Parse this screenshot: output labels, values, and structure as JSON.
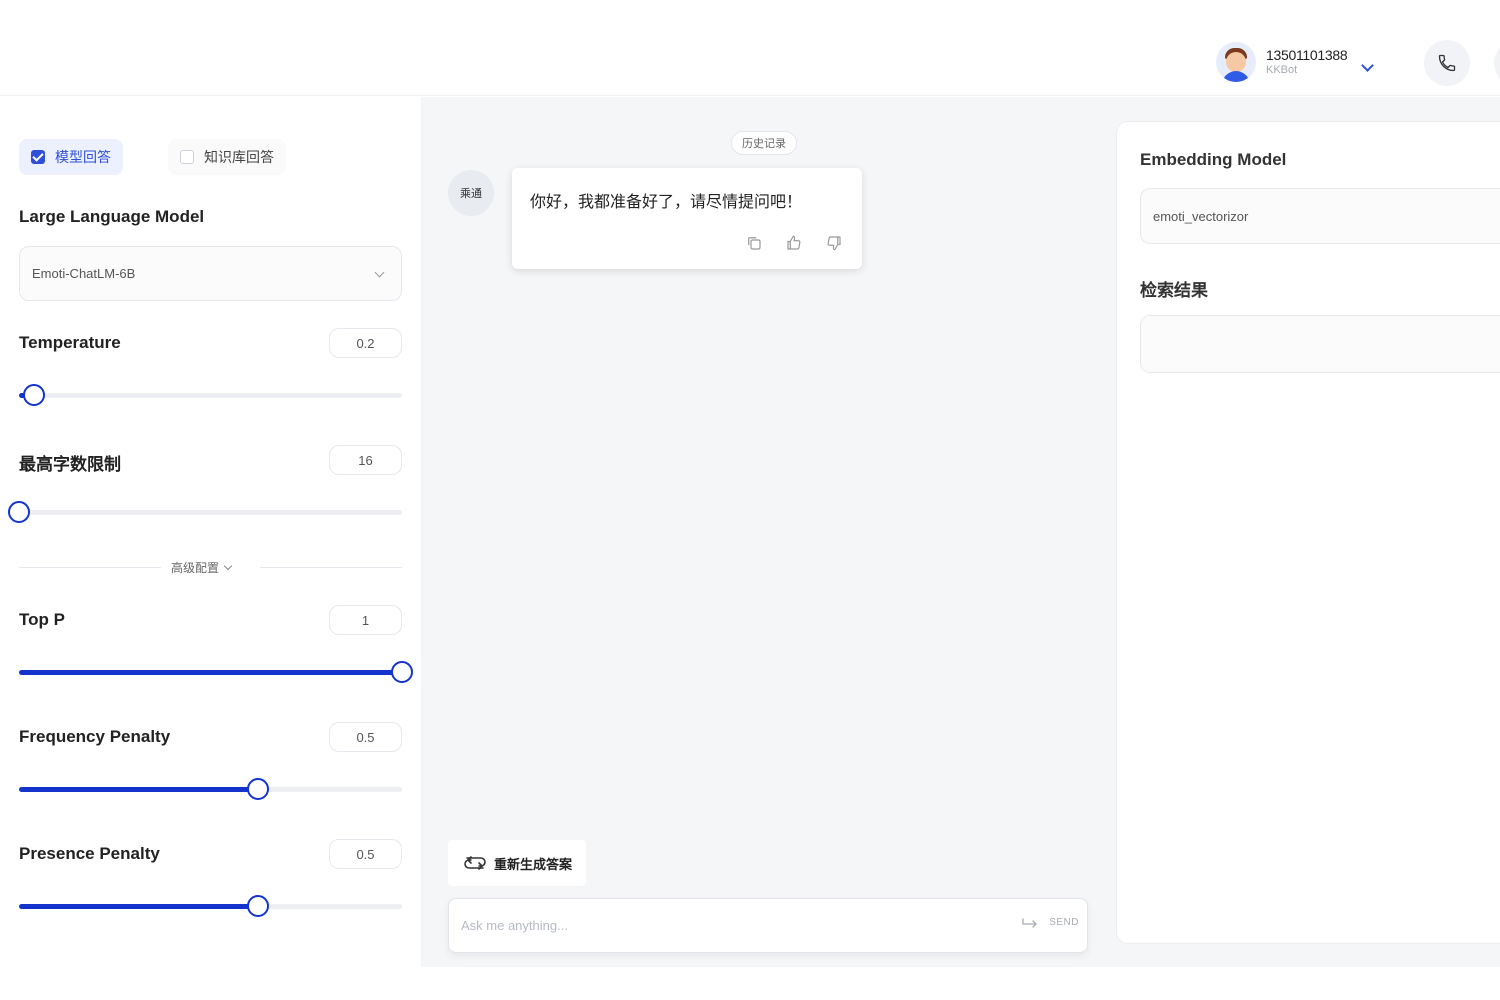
{
  "header": {
    "user_phone": "13501101388",
    "user_role": "KKBot"
  },
  "left_panel": {
    "mode_model_label": "模型回答",
    "mode_kb_label": "知识库回答",
    "llm_label": "Large Language Model",
    "llm_value": "Emoti-ChatLM-6B",
    "temperature": {
      "label": "Temperature",
      "value": "0.2",
      "fraction": 0.04
    },
    "max_tokens": {
      "label": "最高字数限制",
      "value": "16",
      "fraction": 0.0
    },
    "advanced_label": "高级配置",
    "top_p": {
      "label": "Top P",
      "value": "1",
      "fraction": 1.0
    },
    "frequency_penalty": {
      "label": "Frequency Penalty",
      "value": "0.5",
      "fraction": 0.625
    },
    "presence_penalty": {
      "label": "Presence Penalty",
      "value": "0.5",
      "fraction": 0.625
    }
  },
  "chat": {
    "history_label": "历史记录",
    "bot_name": "乘通",
    "message": "你好，我都准备好了，请尽情提问吧！",
    "regenerate_label": "重新生成答案",
    "input_placeholder": "Ask me anything...",
    "send_label": "SEND"
  },
  "right_panel": {
    "embedding_label": "Embedding Model",
    "embedding_value": "emoti_vectorizor",
    "results_label": "检索结果"
  },
  "colors": {
    "accent": "#1433cc",
    "accent_light": "#edf1ff",
    "background": "#f5f6f8"
  }
}
